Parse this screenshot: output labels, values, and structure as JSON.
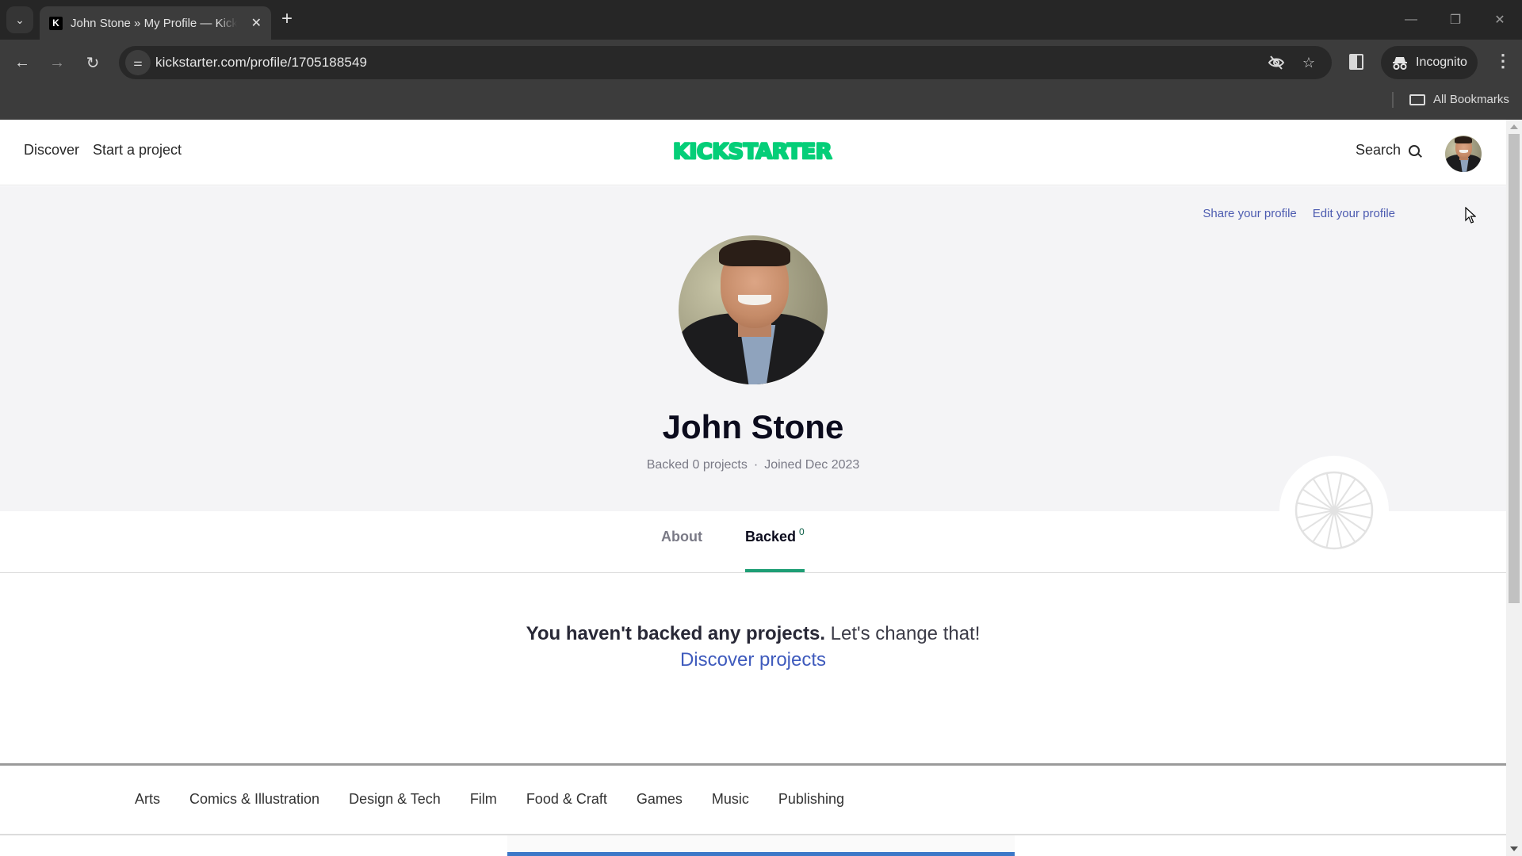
{
  "browser": {
    "tab_title": "John Stone » My Profile — Kickstarter",
    "favicon_letter": "K",
    "url": "kickstarter.com/profile/1705188549",
    "incognito_label": "Incognito",
    "bookmarks_folder": "All Bookmarks",
    "icons": {
      "tab_search": "chevron-down-icon",
      "close": "close-icon",
      "new_tab": "plus-icon",
      "back": "arrow-left-icon",
      "forward": "arrow-right-icon",
      "reload": "reload-icon",
      "site_info": "tune-icon",
      "eye_off": "eye-off-icon",
      "bookmark": "star-icon",
      "side_panel": "side-panel-icon",
      "menu": "kebab-menu-icon"
    },
    "glyphs": {
      "tab_search": "⌄",
      "close": "✕",
      "new_tab": "+",
      "back": "←",
      "forward": "→",
      "reload": "↻",
      "site_info": "⚌",
      "eye_off": "◎",
      "star": "☆",
      "menu": "⋮",
      "minimize": "—",
      "maximize": "❐",
      "window_close": "✕"
    }
  },
  "site": {
    "nav": {
      "discover": "Discover",
      "start_project": "Start a project",
      "search": "Search"
    },
    "brand": {
      "name": "KICKSTARTER",
      "color": "#05ce78"
    }
  },
  "profile": {
    "share_link": "Share your profile",
    "edit_link": "Edit your profile",
    "name": "John Stone",
    "backed_summary": "Backed 0 projects",
    "separator": "·",
    "joined": "Joined Dec 2023",
    "tabs": [
      {
        "label": "About",
        "active": false
      },
      {
        "label": "Backed",
        "count": "0",
        "active": true
      }
    ]
  },
  "empty_state": {
    "headline": "You haven't backed any projects.",
    "subline": "Let's change that!",
    "cta": "Discover projects"
  },
  "categories": [
    "Arts",
    "Comics & Illustration",
    "Design & Tech",
    "Film",
    "Food & Craft",
    "Games",
    "Music",
    "Publishing"
  ],
  "colors": {
    "link": "#4c5bb0",
    "accent_underline": "#1e9e75",
    "chrome_dark": "#3c3c3c"
  }
}
